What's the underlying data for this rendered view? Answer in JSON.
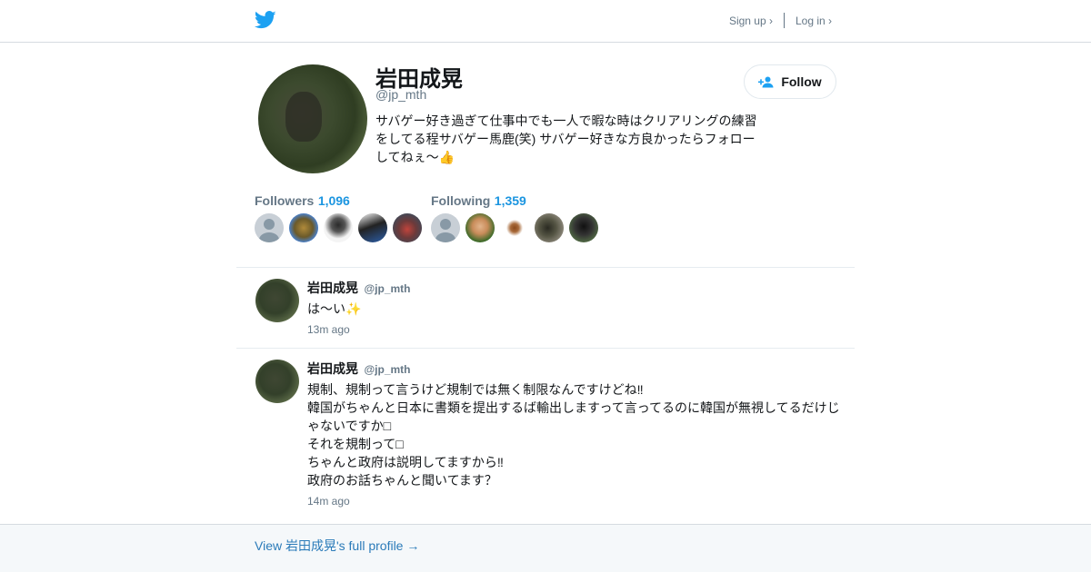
{
  "header": {
    "logo_icon": "twitter-bird-icon",
    "sign_up_label": "Sign up ›",
    "log_in_label": "Log in ›"
  },
  "profile": {
    "name": "岩田成晃",
    "handle": "@jp_mth",
    "bio": "サバゲー好き過ぎて仕事中でも一人で暇な時はクリアリングの練習をしてる程サバゲー馬鹿(笑) サバゲー好きな方良かったらフォローしてねぇ〜👍",
    "follow_label": "Follow",
    "followers_label": "Followers",
    "followers_count": "1,096",
    "following_label": "Following",
    "following_count": "1,359"
  },
  "tweets": [
    {
      "name": "岩田成晃",
      "handle": "@jp_mth",
      "text": "は〜い✨",
      "time": "13m ago"
    },
    {
      "name": "岩田成晃",
      "handle": "@jp_mth",
      "text": "規制、規制って言うけど規制では無く制限なんですけどね‼\n韓国がちゃんと日本に書類を提出するば輸出しますって言ってるのに韓国が無視してるだけじゃないですか□\nそれを規制って□\nちゃんと政府は説明してますから‼\n政府のお話ちゃんと聞いてます？",
      "time": "14m ago"
    }
  ],
  "footer": {
    "full_profile_link": "View 岩田成晃's full profile →"
  },
  "colors": {
    "brand_blue": "#1da1f2",
    "count_blue": "#1b95e0",
    "link_blue": "#2b7bb9"
  }
}
